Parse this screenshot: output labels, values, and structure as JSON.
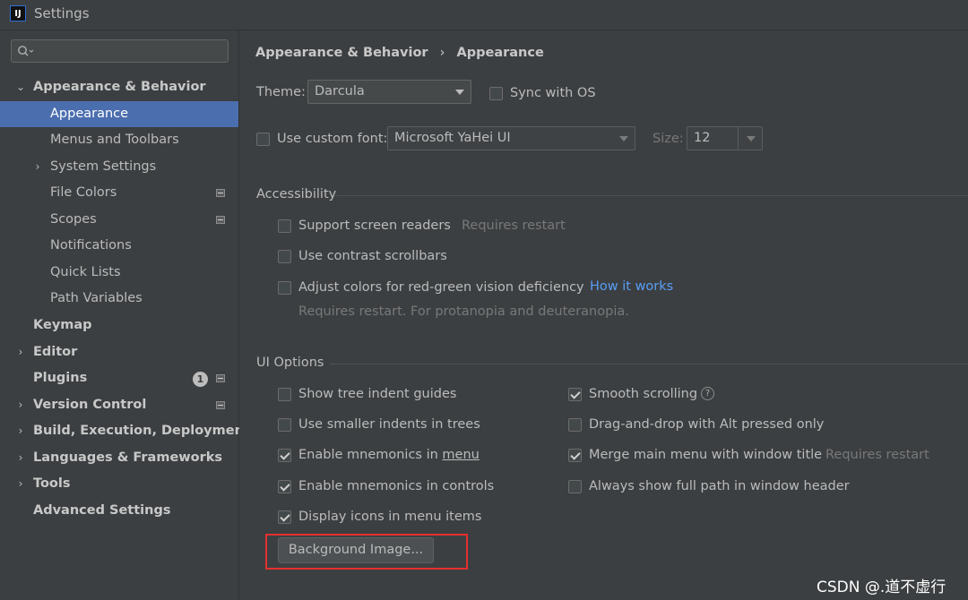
{
  "window": {
    "title": "Settings",
    "app_icon": "IJ"
  },
  "search": {
    "placeholder": ""
  },
  "sidebar": {
    "items": [
      {
        "label": "Appearance & Behavior",
        "expanded": true,
        "arrow": "⌄"
      },
      {
        "label": "Appearance",
        "selected": true
      },
      {
        "label": "Menus and Toolbars"
      },
      {
        "label": "System Settings",
        "arrow": "›"
      },
      {
        "label": "File Colors"
      },
      {
        "label": "Scopes"
      },
      {
        "label": "Notifications"
      },
      {
        "label": "Quick Lists"
      },
      {
        "label": "Path Variables"
      },
      {
        "label": "Keymap"
      },
      {
        "label": "Editor",
        "arrow": "›"
      },
      {
        "label": "Plugins",
        "badge": "1"
      },
      {
        "label": "Version Control",
        "arrow": "›"
      },
      {
        "label": "Build, Execution, Deployment",
        "arrow": "›"
      },
      {
        "label": "Languages & Frameworks",
        "arrow": "›"
      },
      {
        "label": "Tools",
        "arrow": "›"
      },
      {
        "label": "Advanced Settings"
      }
    ]
  },
  "breadcrumb": {
    "parent": "Appearance & Behavior",
    "separator": "›",
    "current": "Appearance"
  },
  "theme": {
    "label": "Theme:",
    "value": "Darcula",
    "sync_label": "Sync with OS",
    "sync_checked": false
  },
  "font": {
    "use_custom_label": "Use custom font:",
    "use_custom_checked": false,
    "value": "Microsoft YaHei UI",
    "size_label": "Size:",
    "size_value": "12"
  },
  "accessibility": {
    "title": "Accessibility",
    "screen_readers": {
      "label": "Support screen readers",
      "hint": "Requires restart",
      "checked": false
    },
    "contrast_scrollbars": {
      "label": "Use contrast scrollbars",
      "checked": false
    },
    "color_deficiency": {
      "label": "Adjust colors for red-green vision deficiency",
      "link": "How it works",
      "hint": "Requires restart. For protanopia and deuteranopia.",
      "checked": false
    }
  },
  "ui_options": {
    "title": "UI Options",
    "left": [
      {
        "label": "Show tree indent guides",
        "checked": false
      },
      {
        "label": "Use smaller indents in trees",
        "checked": false
      },
      {
        "label_pre": "Enable mnemonics in ",
        "label_mn": "menu",
        "checked": true
      },
      {
        "label": "Enable mnemonics in controls",
        "checked": true
      },
      {
        "label": "Display icons in menu items",
        "checked": true
      }
    ],
    "right": [
      {
        "label": "Smooth scrolling",
        "checked": true,
        "help": "?"
      },
      {
        "label": "Drag-and-drop with Alt pressed only",
        "checked": false
      },
      {
        "label": "Merge main menu with window title",
        "hint": "Requires restart",
        "checked": true
      },
      {
        "label": "Always show full path in window header",
        "checked": false
      }
    ],
    "background_button": "Background Image..."
  },
  "highlight_color": "#e53030",
  "watermark": "CSDN @.道不虚行"
}
